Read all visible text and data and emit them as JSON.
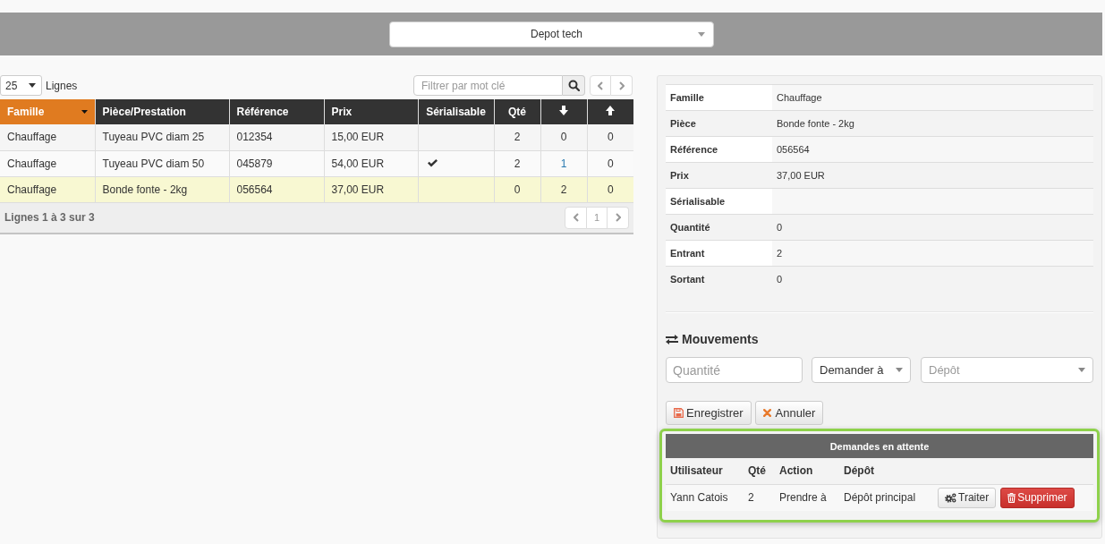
{
  "depot_select": {
    "value": "Depot tech"
  },
  "table_controls": {
    "page_size": "25",
    "page_size_label": "Lignes",
    "filter": {
      "placeholder": "Filtrer par mot clé"
    }
  },
  "table": {
    "columns": [
      {
        "label": "Famille",
        "kind": "text",
        "sorted": true
      },
      {
        "label": "Pièce/Prestation",
        "kind": "text",
        "sorted": false
      },
      {
        "label": "Référence",
        "kind": "text",
        "sorted": false
      },
      {
        "label": "Prix",
        "kind": "text",
        "sorted": false
      },
      {
        "label": "Sérialisable",
        "kind": "text",
        "sorted": false
      },
      {
        "label": "Qté",
        "kind": "text",
        "sorted": false
      },
      {
        "kind": "incoming",
        "sorted": false
      },
      {
        "kind": "outgoing",
        "sorted": false
      }
    ],
    "rows": [
      {
        "selected": false,
        "family": "Chauffage",
        "piece": "Tuyeau PVC diam 25",
        "reference": "012354",
        "price": "15,00 EUR",
        "serializable": false,
        "quantity": "2",
        "incoming": "0",
        "incoming_link": false,
        "outgoing": "0"
      },
      {
        "selected": false,
        "family": "Chauffage",
        "piece": "Tuyeau PVC diam 50",
        "reference": "045879",
        "price": "54,00 EUR",
        "serializable": true,
        "quantity": "2",
        "incoming": "1",
        "incoming_link": true,
        "outgoing": "0"
      },
      {
        "selected": true,
        "family": "Chauffage",
        "piece": "Bonde fonte - 2kg",
        "reference": "056564",
        "price": "37,00 EUR",
        "serializable": false,
        "quantity": "0",
        "incoming": "2",
        "incoming_link": false,
        "outgoing": "0"
      }
    ]
  },
  "table_footer": {
    "summary": "Lignes 1 à 3 sur 3",
    "pages": [
      {
        "label": "1",
        "selected": true
      }
    ]
  },
  "details": [
    {
      "label": "Famille",
      "value": "Chauffage"
    },
    {
      "label": "Pièce",
      "value": "Bonde fonte - 2kg"
    },
    {
      "label": "Référence",
      "value": "056564"
    },
    {
      "label": "Prix",
      "value": "37,00 EUR"
    },
    {
      "label": "Sérialisable"
    },
    {
      "label": "Quantité",
      "value": "0"
    },
    {
      "label": "Entrant",
      "value": "2"
    },
    {
      "label": "Sortant",
      "value": "0"
    }
  ],
  "movements": {
    "title": "Mouvements",
    "quantity": {
      "placeholder": "Quantité"
    },
    "action_select": {
      "value": "Demander à"
    },
    "depot_select": {
      "placeholder": "Dépôt"
    },
    "buttons": [
      {
        "label": "Enregistrer",
        "kind": "save"
      },
      {
        "label": "Annuler",
        "kind": "cancel"
      }
    ]
  },
  "pending_requests": {
    "title": "Demandes en attente",
    "columns": [
      "Utilisateur",
      "Qté",
      "Action",
      "Dépôt"
    ],
    "rows": [
      {
        "cells": [
          "Yann Catois",
          "2",
          "Prendre à",
          "Dépôt principal"
        ],
        "buttons": [
          {
            "label": "Traiter",
            "kind": "process"
          },
          {
            "label": "Supprimer",
            "kind": "delete"
          }
        ]
      }
    ]
  }
}
